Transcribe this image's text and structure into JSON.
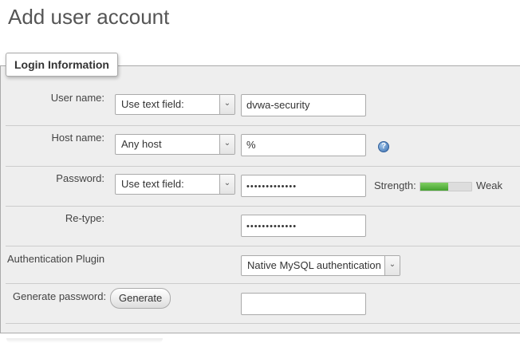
{
  "page": {
    "title": "Add user account"
  },
  "login_info": {
    "legend": "Login Information",
    "username": {
      "label": "User name:",
      "mode_selected": "Use text field:",
      "value": "dvwa-security"
    },
    "hostname": {
      "label": "Host name:",
      "mode_selected": "Any host",
      "value": "%",
      "help_icon": "help-icon",
      "help_glyph": "?"
    },
    "password": {
      "label": "Password:",
      "mode_selected": "Use text field:",
      "masked_value": "•••••••••••••",
      "strength_label": "Strength:",
      "strength_text": "Weak",
      "strength_fraction": 0.55,
      "strength_color": "#44a12f"
    },
    "retype": {
      "label": "Re-type:",
      "masked_value": "•••••••••••••"
    },
    "auth_plugin": {
      "label": "Authentication Plugin",
      "selected": "Native MySQL authentication"
    },
    "generate": {
      "label": "Generate password:",
      "button_label": "Generate",
      "value": ""
    }
  },
  "icons": {
    "dropdown_arrow": "chevron-down-icon",
    "arrow_glyph": "⌄"
  }
}
